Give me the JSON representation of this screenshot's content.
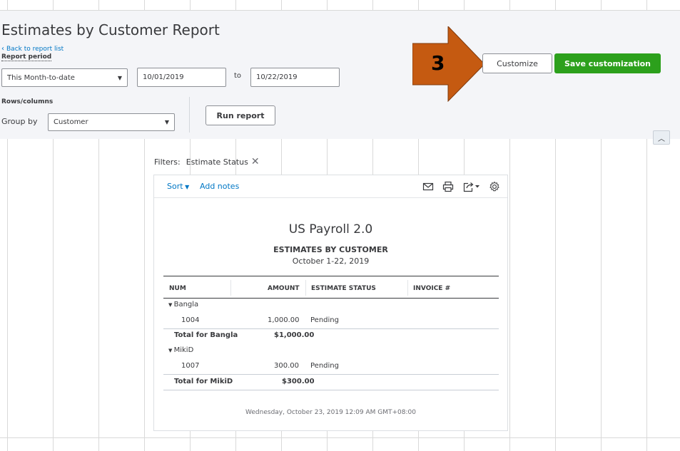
{
  "header": {
    "title": "Estimates by Customer Report",
    "back_link": "Back to report list",
    "report_period_label": "Report period",
    "period_select": "This Month-to-date",
    "date_from": "10/01/2019",
    "to_label": "to",
    "date_to": "10/22/2019",
    "rows_columns_label": "Rows/columns",
    "group_by_label": "Group by",
    "group_by_value": "Customer",
    "run_report": "Run report",
    "customize": "Customize",
    "save_customization": "Save customization"
  },
  "callout": {
    "number": "3",
    "color": "#c55a11"
  },
  "filters": {
    "label": "Filters:",
    "value": "Estimate Status"
  },
  "toolbar": {
    "sort": "Sort",
    "add_notes": "Add notes",
    "icons": [
      "mail-icon",
      "print-icon",
      "export-icon",
      "gear-icon"
    ]
  },
  "report": {
    "company": "US Payroll 2.0",
    "title": "ESTIMATES BY CUSTOMER",
    "date_range": "October 1-22, 2019",
    "columns": [
      "NUM",
      "AMOUNT",
      "ESTIMATE STATUS",
      "INVOICE #"
    ],
    "groups": [
      {
        "name": "Bangla",
        "rows": [
          {
            "num": "1004",
            "amount": "1,000.00",
            "status": "Pending",
            "invoice": ""
          }
        ],
        "total_label": "Total for Bangla",
        "total": "$1,000.00"
      },
      {
        "name": "MikiD",
        "rows": [
          {
            "num": "1007",
            "amount": "300.00",
            "status": "Pending",
            "invoice": ""
          }
        ],
        "total_label": "Total for MikiD",
        "total": "$300.00"
      }
    ],
    "footer": "Wednesday, October 23, 2019   12:09 AM GMT+08:00"
  },
  "colors": {
    "accent_green": "#2ca01c",
    "link_blue": "#0077c5",
    "header_bg": "#f4f5f8"
  }
}
